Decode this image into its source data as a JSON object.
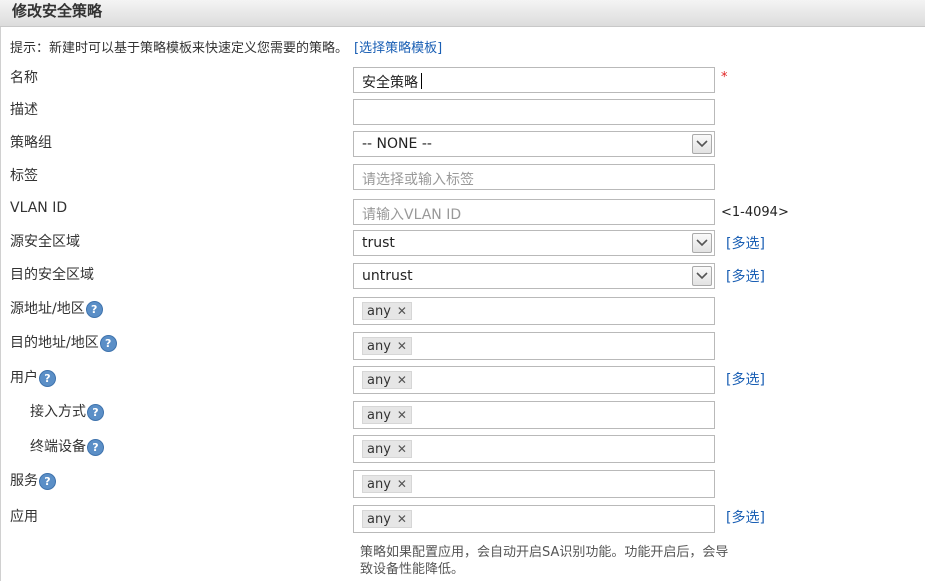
{
  "window": {
    "title": "修改安全策略"
  },
  "hint": {
    "text": "提示：新建时可以基于策略模板来快速定义您需要的策略。",
    "link": "[选择策略模板]"
  },
  "fields": {
    "name": {
      "label": "名称",
      "value": "安全策略",
      "required_mark": "*"
    },
    "description": {
      "label": "描述",
      "value": ""
    },
    "policy_group": {
      "label": "策略组",
      "value": "-- NONE --"
    },
    "tag": {
      "label": "标签",
      "placeholder": "请选择或输入标签"
    },
    "vlan": {
      "label": "VLAN ID",
      "placeholder": "请输入VLAN ID",
      "range": "<1-4094>"
    },
    "src_zone": {
      "label": "源安全区域",
      "value": "trust",
      "multi": "[多选]"
    },
    "dst_zone": {
      "label": "目的安全区域",
      "value": "untrust",
      "multi": "[多选]"
    },
    "src_addr": {
      "label": "源地址/地区",
      "tag": "any"
    },
    "dst_addr": {
      "label": "目的地址/地区",
      "tag": "any"
    },
    "user": {
      "label": "用户",
      "tag": "any",
      "multi": "[多选]"
    },
    "access_mode": {
      "label": "接入方式",
      "tag": "any"
    },
    "terminal": {
      "label": "终端设备",
      "tag": "any"
    },
    "service": {
      "label": "服务",
      "tag": "any"
    },
    "application": {
      "label": "应用",
      "tag": "any",
      "multi": "[多选]"
    }
  },
  "app_note": "策略如果配置应用，会自动开启SA识别功能。功能开启后，会导致设备性能降低。",
  "icons": {
    "help": "?",
    "remove": "✕"
  }
}
